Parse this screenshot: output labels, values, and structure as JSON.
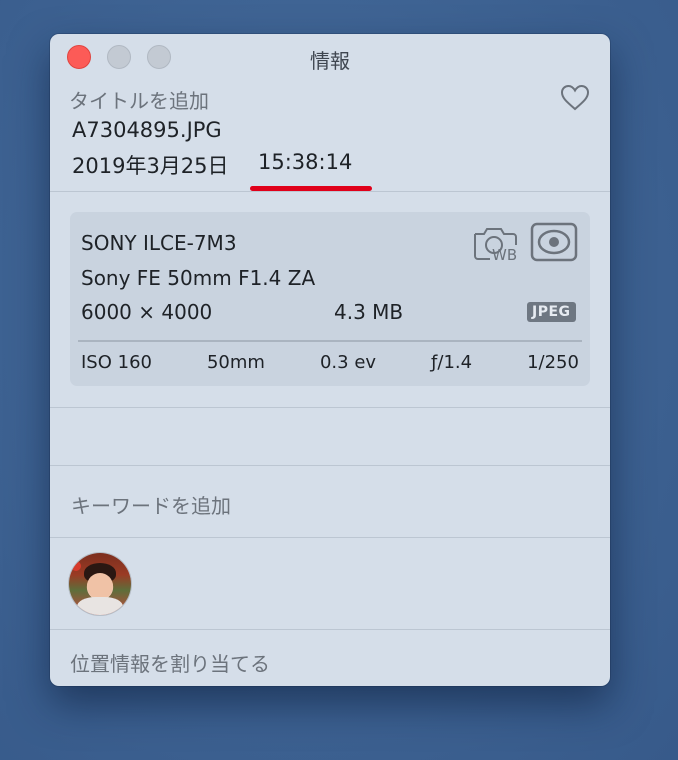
{
  "window": {
    "title": "情報"
  },
  "photo": {
    "title_placeholder": "タイトルを追加",
    "filename": "A7304895.JPG",
    "date": "2019年3月25日",
    "time": "15:38:14"
  },
  "exif": {
    "camera": "SONY ILCE-7M3",
    "lens": "Sony FE 50mm F1.4 ZA",
    "dimensions": "6000 × 4000",
    "file_size": "4.3 MB",
    "format_badge": "JPEG",
    "iso": "ISO 160",
    "focal_length": "50mm",
    "exposure_bias": "0.3 ev",
    "aperture": "ƒ/1.4",
    "shutter": "1/250",
    "icons": [
      "white-balance-icon",
      "metering-icon"
    ]
  },
  "keywords": {
    "placeholder": "キーワードを追加"
  },
  "location": {
    "placeholder": "位置情報を割り当てる"
  },
  "colors": {
    "annotation_underline": "#e0001a",
    "window_bg": "#d5dee9",
    "desktop_bg": "#3f6494"
  }
}
